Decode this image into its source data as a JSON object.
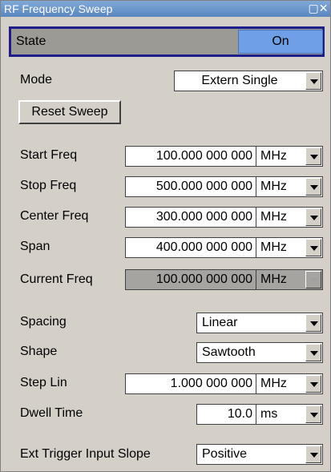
{
  "window": {
    "title": "RF Frequency Sweep",
    "close_glyph": "▢✕"
  },
  "state": {
    "label": "State",
    "value": "On"
  },
  "mode": {
    "label": "Mode",
    "value": "Extern Single"
  },
  "reset_button": "Reset Sweep",
  "start_freq": {
    "label": "Start Freq",
    "value": "100.000 000 000",
    "unit": "MHz"
  },
  "stop_freq": {
    "label": "Stop Freq",
    "value": "500.000 000 000",
    "unit": "MHz"
  },
  "center_freq": {
    "label": "Center Freq",
    "value": "300.000 000 000",
    "unit": "MHz"
  },
  "span": {
    "label": "Span",
    "value": "400.000 000 000",
    "unit": "MHz"
  },
  "current_freq": {
    "label": "Current Freq",
    "value": "100.000 000 000",
    "unit": "MHz"
  },
  "spacing": {
    "label": "Spacing",
    "value": "Linear"
  },
  "shape": {
    "label": "Shape",
    "value": "Sawtooth"
  },
  "step_lin": {
    "label": "Step Lin",
    "value": "1.000 000 000",
    "unit": "MHz"
  },
  "dwell_time": {
    "label": "Dwell Time",
    "value": "10.0",
    "unit": "ms"
  },
  "ext_trigger": {
    "label": "Ext Trigger Input Slope",
    "value": "Positive"
  },
  "colors": {
    "state_on": "#6f9fe6",
    "panel": "#d4d0c8",
    "focus_border": "#1d1d8c"
  }
}
